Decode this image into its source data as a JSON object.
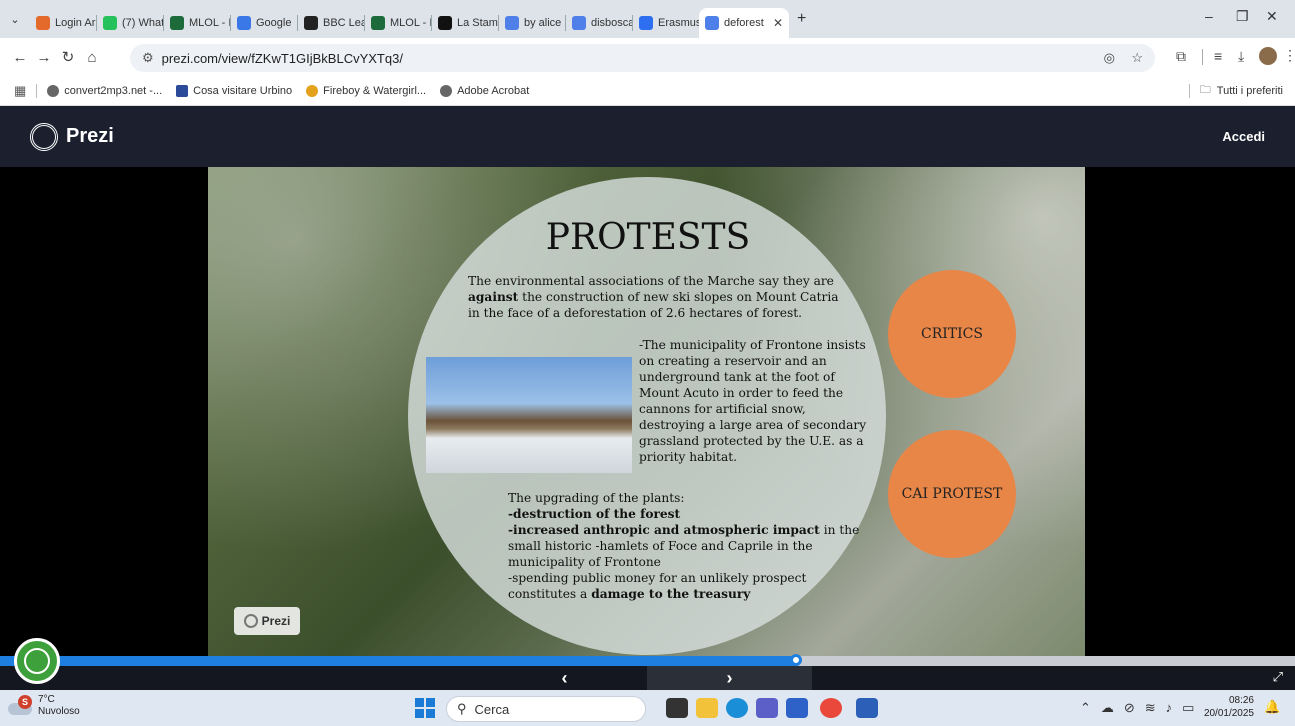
{
  "browser": {
    "tabs": [
      {
        "label": "Login Ar",
        "color": "#e46a2b"
      },
      {
        "label": "(7) What",
        "color": "#25c25b"
      },
      {
        "label": "MLOL - I",
        "color": "#1d6b3a"
      },
      {
        "label": "Google",
        "color": "#3b78e7"
      },
      {
        "label": "BBC Lea",
        "color": "#222222"
      },
      {
        "label": "MLOL - I",
        "color": "#1d6b3a"
      },
      {
        "label": "La Stam",
        "color": "#111111"
      },
      {
        "label": "by alice",
        "color": "#4f7fe8"
      },
      {
        "label": "disbosca",
        "color": "#4f7fe8"
      },
      {
        "label": "Erasmus",
        "color": "#2d6ff0"
      },
      {
        "label": "deforest",
        "color": "#4f7fe8",
        "active": true
      }
    ],
    "url": "prezi.com/view/fZKwT1GIjBkBLCvYXTq3/",
    "bookmarks": [
      "convert2mp3.net -...",
      "Cosa visitare Urbino",
      "Fireboy & Watergirl...",
      "Adobe Acrobat"
    ],
    "all_bookmarks": "Tutti i preferiti"
  },
  "prezi": {
    "brand": "Prezi",
    "login": "Accedi",
    "watermark": "Prezi"
  },
  "slide": {
    "title": "PROTESTS",
    "intro_1": "The environmental associations of the Marche say they are",
    "intro_2_bold": "against",
    "intro_2_rest": " the construction of new ski slopes on Mount Catria",
    "intro_3": "in the face of a deforestation of 2.6 hectares of forest.",
    "frontone": [
      "-The municipality of Frontone insists",
      "on creating a reservoir and an",
      "underground tank at the foot of",
      "Mount Acuto in order to feed the",
      "cannons for artificial snow,",
      "destroying a large area of secondary",
      "grassland protected by the U.E. as a",
      "priority habitat."
    ],
    "upgrading_head": "The upgrading of the plants:",
    "upgrading_1": "-destruction of the forest",
    "upgrading_2_bold": "-increased anthropic and atmospheric impact",
    "upgrading_2_rest": " in the",
    "upgrading_3": "small historic -hamlets of Foce and Caprile in the",
    "upgrading_4": "municipality of Frontone",
    "upgrading_5": "-spending public money for an unlikely prospect",
    "upgrading_6_rest": "constitutes a ",
    "upgrading_6_bold": "damage to the treasury",
    "critics": "CRITICS",
    "cai_protest": "CAI PROTEST"
  },
  "player": {
    "progress_fraction": 0.615,
    "prev": "‹",
    "next": "›"
  },
  "taskbar": {
    "weather_temp": "7°C",
    "weather_desc": "Nuvoloso",
    "weather_badge": "S",
    "search_placeholder": "Cerca",
    "time": "08:26",
    "date": "20/01/2025"
  }
}
